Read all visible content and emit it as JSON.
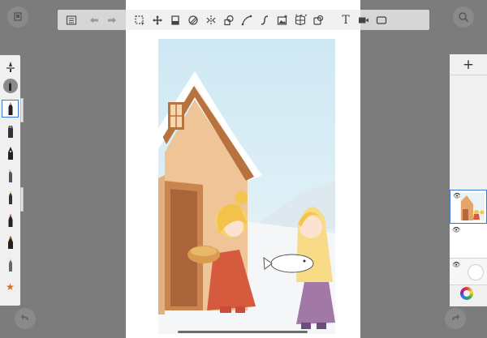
{
  "toolbar": {
    "grip": "•••",
    "buttons": [
      "gallery-icon",
      "undo-icon",
      "redo-icon",
      "selection-icon",
      "transform-icon",
      "fill-icon",
      "gradient-icon",
      "symmetry-icon",
      "shape-icon",
      "curve-icon",
      "ruler-icon",
      "image-import-icon",
      "perspective-icon",
      "stencil-icon",
      "text-icon",
      "video-icon",
      "screen-icon"
    ],
    "text_tool": "T"
  },
  "corner_buttons": {
    "top_left": "layer-toggle-icon",
    "top_right": "zoom-icon",
    "bottom_left": "undo-round-icon",
    "bottom_right": "redo-round-icon"
  },
  "brush_panel": {
    "brushes": [
      "brush-size-icon",
      "airbrush-icon",
      "pencil-icon",
      "marker-icon",
      "ink-pen-icon",
      "chisel-icon",
      "fine-pen-icon",
      "brush-pen-icon",
      "paint-brush-icon",
      "technical-pen-icon",
      "eraser-icon"
    ],
    "favorite": "★",
    "selected_index": 2
  },
  "layers": {
    "add_label": "+",
    "eye": "👁"
  },
  "colors": {
    "accent": "#3c78d8",
    "background": "#7c7c7c",
    "panel": "#f0f0f0"
  }
}
